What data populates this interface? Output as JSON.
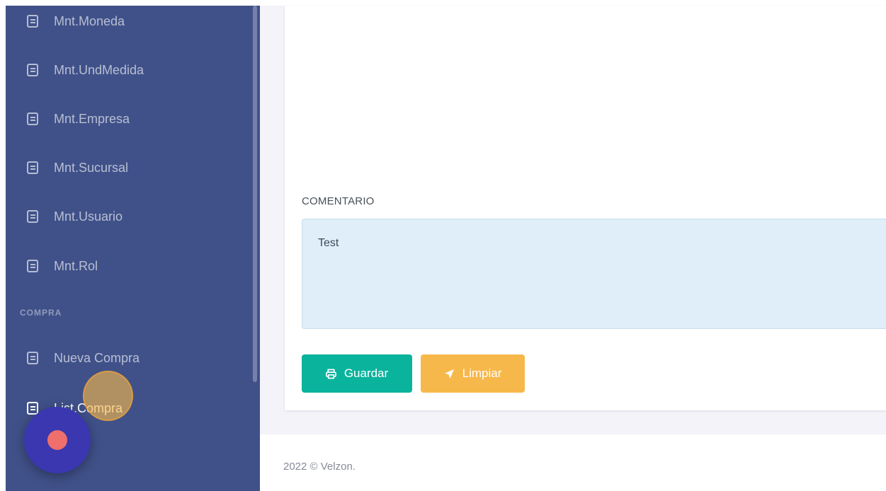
{
  "sidebar": {
    "items": [
      {
        "label": "Mnt.Moneda"
      },
      {
        "label": "Mnt.UndMedida"
      },
      {
        "label": "Mnt.Empresa"
      },
      {
        "label": "Mnt.Sucursal"
      },
      {
        "label": "Mnt.Usuario"
      },
      {
        "label": "Mnt.Rol"
      }
    ],
    "section_compra": "COMPRA",
    "compra_items": [
      {
        "label": "Nueva Compra"
      },
      {
        "label": "List.Compra"
      }
    ],
    "icon": "list-icon"
  },
  "form": {
    "comment_label": "COMENTARIO",
    "comment_value": "Test",
    "save_label": "Guardar",
    "clear_label": "Limpiar",
    "save_icon": "printer-icon",
    "clear_icon": "send-icon"
  },
  "footer": {
    "text": "2022 © Velzon."
  },
  "colors": {
    "sidebar": "#405189",
    "success": "#0ab39c",
    "warning": "#f7b84b",
    "record": "#3a37b0"
  }
}
